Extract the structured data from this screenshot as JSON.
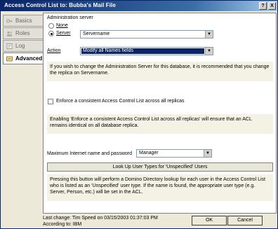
{
  "window": {
    "title": "Access Control List to: Bubba's Mail File",
    "help_glyph": "?",
    "close_glyph": "X"
  },
  "tabs": [
    {
      "label": "Basics",
      "icon": "key-icon"
    },
    {
      "label": "Roles",
      "icon": "roles-icon"
    },
    {
      "label": "Log",
      "icon": "log-icon"
    },
    {
      "label": "Advanced",
      "icon": "advanced-icon",
      "active": true
    }
  ],
  "admin_server": {
    "heading": "Administration server",
    "none_label": "None",
    "server_label": "Server",
    "selected": "server",
    "server_value": "Servername"
  },
  "action": {
    "label": "Action",
    "value": "Modify all Names fields"
  },
  "notes": {
    "admin_note": "If you wish to change the Administration Server for this database, it is recommended that you change the replica on Servername.",
    "enforce_note": "Enabling 'Enforce a consistent Access Control List across all replicas' will ensure that an ACL remains identical on all database replica.",
    "lookup_note": "Pressing this button will perform a Domino Directory lookup for each user in the Access Control List who is listed as an 'Unspecified' user type.  If the name is found, the appropriate user type (e.g. Server, Person, etc.) will be set in the ACL."
  },
  "enforce": {
    "label": "Enforce a consistent Access Control List across all replicas",
    "checked": false
  },
  "internet": {
    "label": "Maximum Internet name and password",
    "value": "Manager"
  },
  "lookup_button": "Look Up User Types for 'Unspecified' Users",
  "footer": {
    "last_change": "Last change: Tim Speed on 03/15/2003 01:37:03 PM",
    "according": "According to: IBM"
  },
  "buttons": {
    "ok": "OK",
    "cancel": "Cancel"
  },
  "arrow_glyph": "▼"
}
